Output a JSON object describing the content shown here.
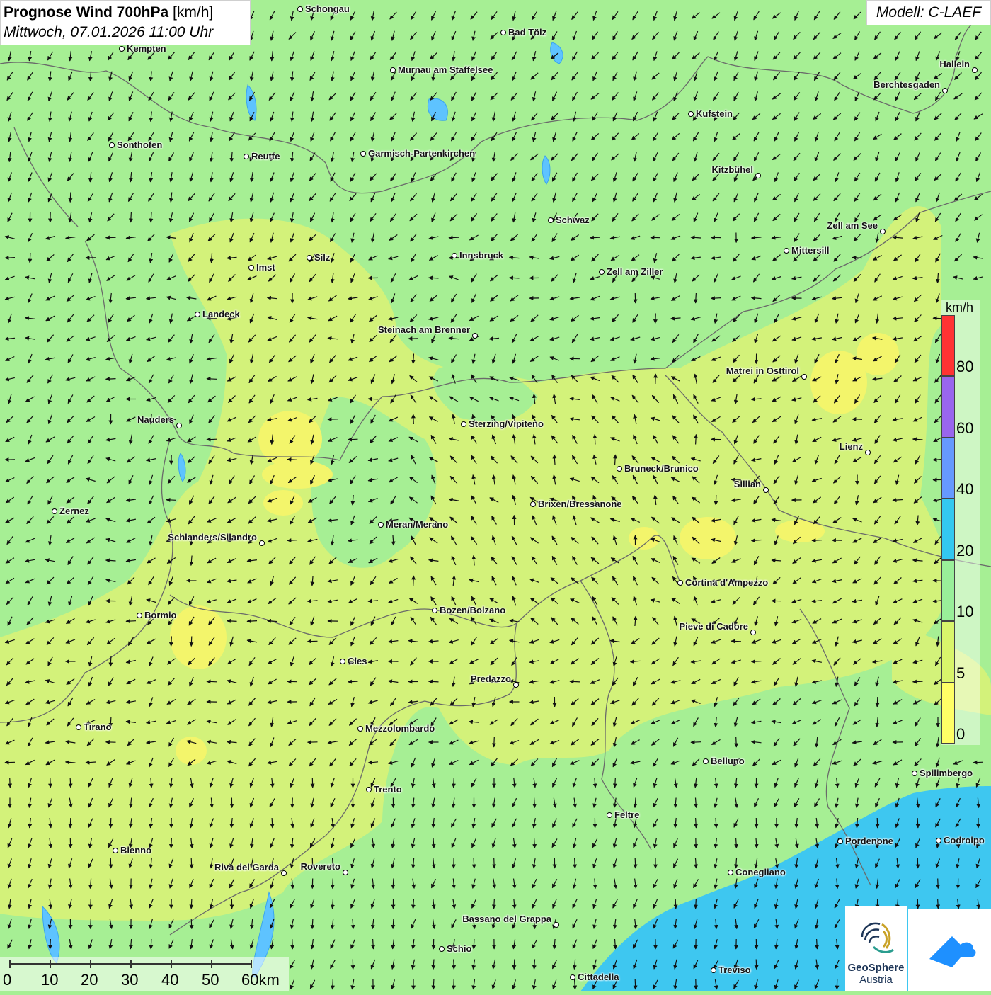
{
  "header": {
    "title_bold": "Prognose Wind 700hPa",
    "title_unit": "[km/h]",
    "datetime": "Mittwoch, 07.01.2026 11:00 Uhr",
    "model": "Modell: C-LAEF"
  },
  "legend": {
    "unit": "km/h",
    "bins": [
      {
        "label": "0",
        "color": "#ffff66"
      },
      {
        "label": "5",
        "color": "#d9f56b"
      },
      {
        "label": "10",
        "color": "#99ef99"
      },
      {
        "label": "20",
        "color": "#33c8f0"
      },
      {
        "label": "40",
        "color": "#6699ff"
      },
      {
        "label": "60",
        "color": "#9966ee"
      },
      {
        "label": "80",
        "color": "#ff3333"
      }
    ]
  },
  "scale_bar": {
    "labels": [
      "0",
      "10",
      "20",
      "30",
      "40",
      "50",
      "60km"
    ]
  },
  "logos": {
    "geosphere_line1": "GeoSphere",
    "geosphere_line2": "Austria"
  },
  "cities": [
    {
      "name": "Schongau"
    },
    {
      "name": "Bad Tölz"
    },
    {
      "name": "Kempten"
    },
    {
      "name": "Murnau am Staffelsee"
    },
    {
      "name": "Hallein"
    },
    {
      "name": "Berchtesgaden"
    },
    {
      "name": "Kufstein"
    },
    {
      "name": "Sonthofen"
    },
    {
      "name": "Reutte"
    },
    {
      "name": "Garmisch-Partenkirchen"
    },
    {
      "name": "Kitzbühel"
    },
    {
      "name": "Schwaz"
    },
    {
      "name": "Zell am See"
    },
    {
      "name": "Mittersill"
    },
    {
      "name": "Silz"
    },
    {
      "name": "Innsbruck"
    },
    {
      "name": "Imst"
    },
    {
      "name": "Zell am Ziller"
    },
    {
      "name": "Landeck"
    },
    {
      "name": "Steinach am Brenner"
    },
    {
      "name": "Matrei in Osttirol"
    },
    {
      "name": "Nauders"
    },
    {
      "name": "Sterzing/Vipiteno"
    },
    {
      "name": "Lienz"
    },
    {
      "name": "Bruneck/Brunico"
    },
    {
      "name": "Sillian"
    },
    {
      "name": "Zernez"
    },
    {
      "name": "Brixen/Bressanone"
    },
    {
      "name": "Meran/Merano"
    },
    {
      "name": "Schlanders/Silandro"
    },
    {
      "name": "Cortina d'Ampezzo"
    },
    {
      "name": "Bozen/Bolzano"
    },
    {
      "name": "Bormio"
    },
    {
      "name": "Pieve di Cadore"
    },
    {
      "name": "Cles"
    },
    {
      "name": "Predazzo"
    },
    {
      "name": "Tirano"
    },
    {
      "name": "Mezzolombardo"
    },
    {
      "name": "Belluno"
    },
    {
      "name": "Spilimbergo"
    },
    {
      "name": "Trento"
    },
    {
      "name": "Feltre"
    },
    {
      "name": "Pordenone"
    },
    {
      "name": "Codroipo"
    },
    {
      "name": "Bienno"
    },
    {
      "name": "Riva del Garda"
    },
    {
      "name": "Rovereto"
    },
    {
      "name": "Conegliano"
    },
    {
      "name": "Bassano del Grappa"
    },
    {
      "name": "Schio"
    },
    {
      "name": "Treviso"
    },
    {
      "name": "Cittadella"
    }
  ]
}
